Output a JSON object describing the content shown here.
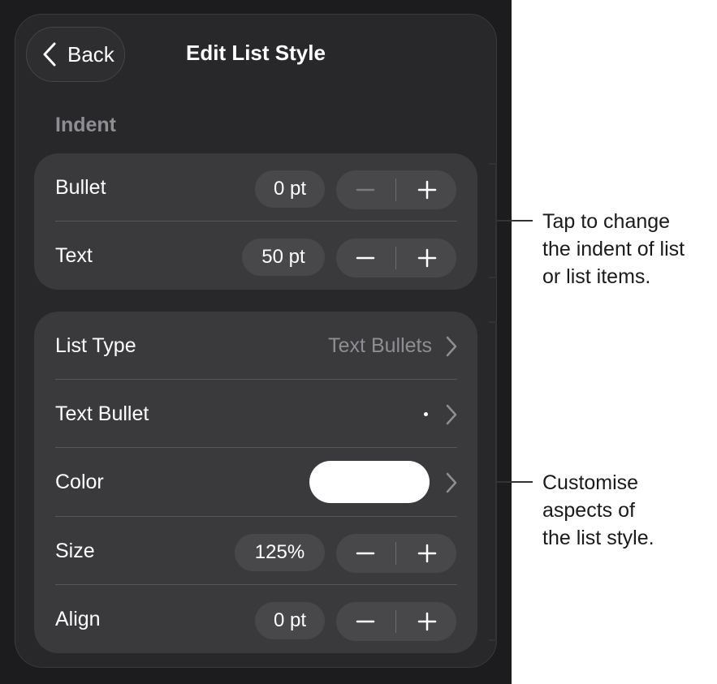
{
  "header": {
    "back_label": "Back",
    "title": "Edit List Style"
  },
  "indent": {
    "section_label": "Indent",
    "rows": [
      {
        "label": "Bullet",
        "value": "0 pt",
        "minus_enabled": false
      },
      {
        "label": "Text",
        "value": "50 pt",
        "minus_enabled": true
      }
    ]
  },
  "style": {
    "list_type": {
      "label": "List Type",
      "value": "Text Bullets"
    },
    "text_bullet": {
      "label": "Text Bullet",
      "value": "•"
    },
    "color": {
      "label": "Color",
      "swatch": "#ffffff"
    },
    "size": {
      "label": "Size",
      "value": "125%"
    },
    "align": {
      "label": "Align",
      "value": "0 pt"
    }
  },
  "callouts": {
    "indent": "Tap to change\nthe indent of list\nor list items.",
    "style": "Customise\naspects of\nthe list style."
  }
}
